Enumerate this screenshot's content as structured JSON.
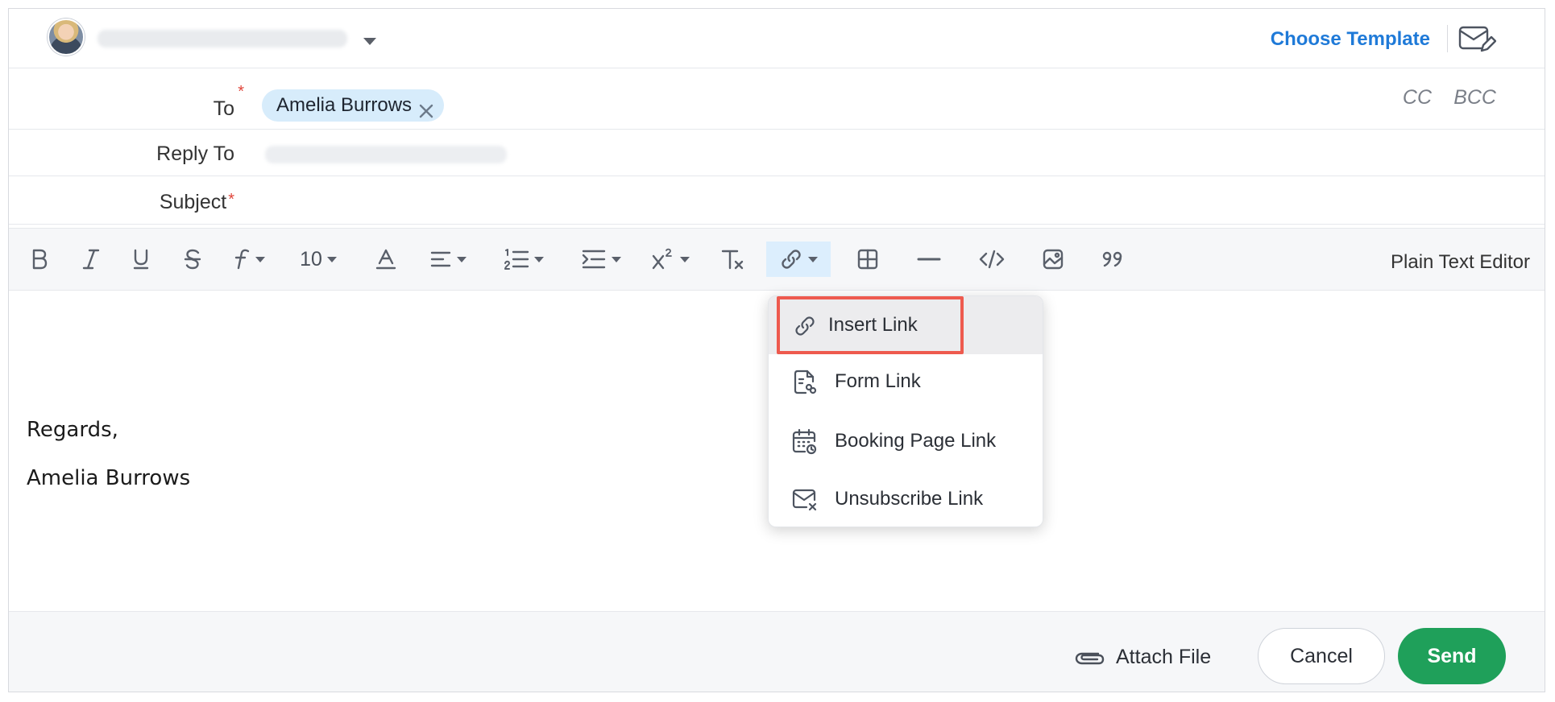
{
  "header": {
    "choose_template": "Choose Template"
  },
  "fields": {
    "to_label": "To",
    "to_chip": "Amelia Burrows",
    "cc": "CC",
    "bcc": "BCC",
    "reply_to_label": "Reply To",
    "subject_label": "Subject",
    "required_mark": "*"
  },
  "toolbar": {
    "font_size": "10",
    "plain_text_editor": "Plain Text Editor"
  },
  "editor": {
    "signature_line1": "Regards,",
    "signature_line2": "Amelia Burrows"
  },
  "link_menu": {
    "items": [
      {
        "label": "Insert Link",
        "icon": "link-icon"
      },
      {
        "label": "Form Link",
        "icon": "form-link-icon"
      },
      {
        "label": "Booking Page Link",
        "icon": "calendar-icon"
      },
      {
        "label": "Unsubscribe Link",
        "icon": "mail-x-icon"
      }
    ]
  },
  "footer": {
    "attach_file": "Attach File",
    "cancel": "Cancel",
    "send": "Send"
  },
  "colors": {
    "accent_blue": "#1f7ad8",
    "send_green": "#1fa05a",
    "chip_bg": "#d7ecfb",
    "highlight_red": "#ee5a4e",
    "required_red": "#e0453a"
  }
}
